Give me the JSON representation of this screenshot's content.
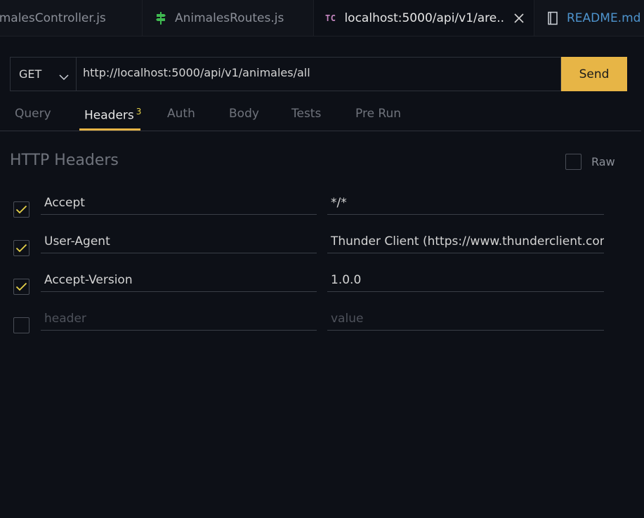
{
  "tabs": [
    {
      "label": "imalesController.js",
      "icon": "js-file-icon"
    },
    {
      "label": "AnimalesRoutes.js",
      "icon": "signpost-icon",
      "icon_color": "#3fb950"
    },
    {
      "label": "localhost:5000/api/v1/are..",
      "icon": "tc-icon",
      "badge": "TC",
      "active": true
    },
    {
      "label": "README.md",
      "icon": "book-icon"
    }
  ],
  "request": {
    "method": "GET",
    "url": "http://localhost:5000/api/v1/animales/all",
    "send_label": "Send"
  },
  "subtabs": [
    {
      "label": "Query"
    },
    {
      "label": "Headers",
      "count": "3",
      "active": true
    },
    {
      "label": "Auth"
    },
    {
      "label": "Body"
    },
    {
      "label": "Tests"
    },
    {
      "label": "Pre Run"
    }
  ],
  "headers_section": {
    "title": "HTTP Headers",
    "raw_label": "Raw",
    "rows": [
      {
        "key": "Accept",
        "value": "*/*",
        "checked": true
      },
      {
        "key": "User-Agent",
        "value": "Thunder Client (https://www.thunderclient.com)",
        "checked": true
      },
      {
        "key": "Accept-Version",
        "value": "1.0.0",
        "checked": true
      }
    ],
    "new_row": {
      "key_placeholder": "header",
      "value_placeholder": "value",
      "checked": false
    }
  },
  "colors": {
    "accent": "#e7b546",
    "check": "#e7d34a",
    "background": "#0d1017"
  }
}
